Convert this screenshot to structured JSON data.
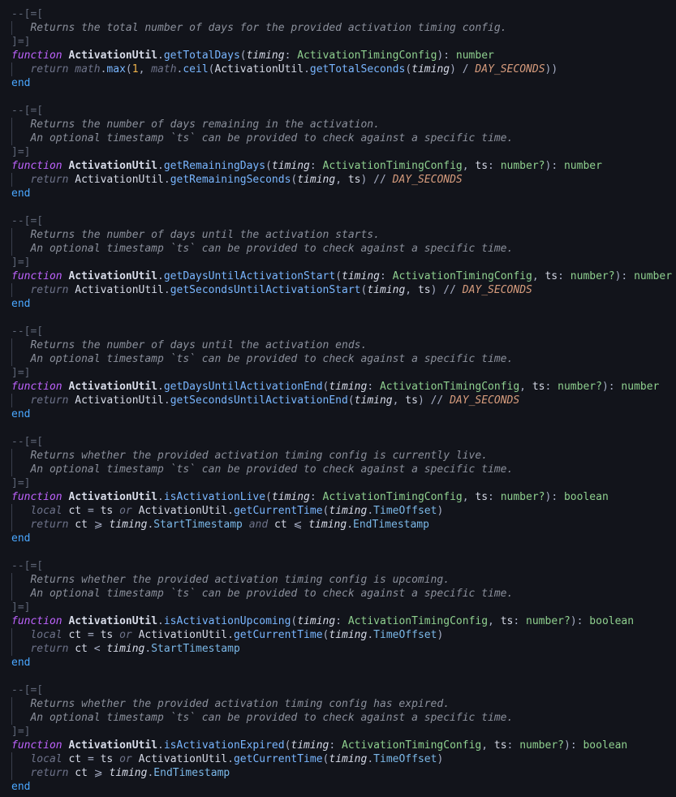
{
  "editor": {
    "language": "Luau",
    "theme_colors": {
      "background": "#12141b",
      "comment": "#5f6677",
      "doc": "#8b909c",
      "keyword_function": "#bf63ff",
      "keyword_end": "#4aa7ff",
      "type": "#8fd08f",
      "constant": "#d79c7d"
    },
    "blocks": [
      {
        "doc_open": "--[=[",
        "doc_lines": [
          "Returns the total number of days for the provided activation timing config."
        ],
        "doc_close": "]=]",
        "kw_function": "function",
        "module": "ActivationUtil",
        "name": "getTotalDays",
        "params": "(timing: ActivationTimingConfig): number",
        "body": [
          "return math.max(1, math.ceil(ActivationUtil.getTotalSeconds(timing) / DAY_SECONDS))"
        ],
        "kw_end": "end"
      },
      {
        "doc_open": "--[=[",
        "doc_lines": [
          "Returns the number of days remaining in the activation.",
          "An optional timestamp `ts` can be provided to check against a specific time."
        ],
        "doc_close": "]=]",
        "kw_function": "function",
        "module": "ActivationUtil",
        "name": "getRemainingDays",
        "params": "(timing: ActivationTimingConfig, ts: number?): number",
        "body": [
          "return ActivationUtil.getRemainingSeconds(timing, ts) // DAY_SECONDS"
        ],
        "kw_end": "end"
      },
      {
        "doc_open": "--[=[",
        "doc_lines": [
          "Returns the number of days until the activation starts.",
          "An optional timestamp `ts` can be provided to check against a specific time."
        ],
        "doc_close": "]=]",
        "kw_function": "function",
        "module": "ActivationUtil",
        "name": "getDaysUntilActivationStart",
        "params": "(timing: ActivationTimingConfig, ts: number?): number",
        "body": [
          "return ActivationUtil.getSecondsUntilActivationStart(timing, ts) // DAY_SECONDS"
        ],
        "kw_end": "end"
      },
      {
        "doc_open": "--[=[",
        "doc_lines": [
          "Returns the number of days until the activation ends.",
          "An optional timestamp `ts` can be provided to check against a specific time."
        ],
        "doc_close": "]=]",
        "kw_function": "function",
        "module": "ActivationUtil",
        "name": "getDaysUntilActivationEnd",
        "params": "(timing: ActivationTimingConfig, ts: number?): number",
        "body": [
          "return ActivationUtil.getSecondsUntilActivationEnd(timing, ts) // DAY_SECONDS"
        ],
        "kw_end": "end"
      },
      {
        "doc_open": "--[=[",
        "doc_lines": [
          "Returns whether the provided activation timing config is currently live.",
          "An optional timestamp `ts` can be provided to check against a specific time."
        ],
        "doc_close": "]=]",
        "kw_function": "function",
        "module": "ActivationUtil",
        "name": "isActivationLive",
        "params": "(timing: ActivationTimingConfig, ts: number?): boolean",
        "body": [
          "local ct = ts or ActivationUtil.getCurrentTime(timing.TimeOffset)",
          "return ct ⩾ timing.StartTimestamp and ct ⩽ timing.EndTimestamp"
        ],
        "kw_end": "end"
      },
      {
        "doc_open": "--[=[",
        "doc_lines": [
          "Returns whether the provided activation timing config is upcoming.",
          "An optional timestamp `ts` can be provided to check against a specific time."
        ],
        "doc_close": "]=]",
        "kw_function": "function",
        "module": "ActivationUtil",
        "name": "isActivationUpcoming",
        "params": "(timing: ActivationTimingConfig, ts: number?): boolean",
        "body": [
          "local ct = ts or ActivationUtil.getCurrentTime(timing.TimeOffset)",
          "return ct < timing.StartTimestamp"
        ],
        "kw_end": "end"
      },
      {
        "doc_open": "--[=[",
        "doc_lines": [
          "Returns whether the provided activation timing config has expired.",
          "An optional timestamp `ts` can be provided to check against a specific time."
        ],
        "doc_close": "]=]",
        "kw_function": "function",
        "module": "ActivationUtil",
        "name": "isActivationExpired",
        "params": "(timing: ActivationTimingConfig, ts: number?): boolean",
        "body": [
          "local ct = ts or ActivationUtil.getCurrentTime(timing.TimeOffset)",
          "return ct ⩾ timing.EndTimestamp"
        ],
        "kw_end": "end"
      }
    ]
  }
}
